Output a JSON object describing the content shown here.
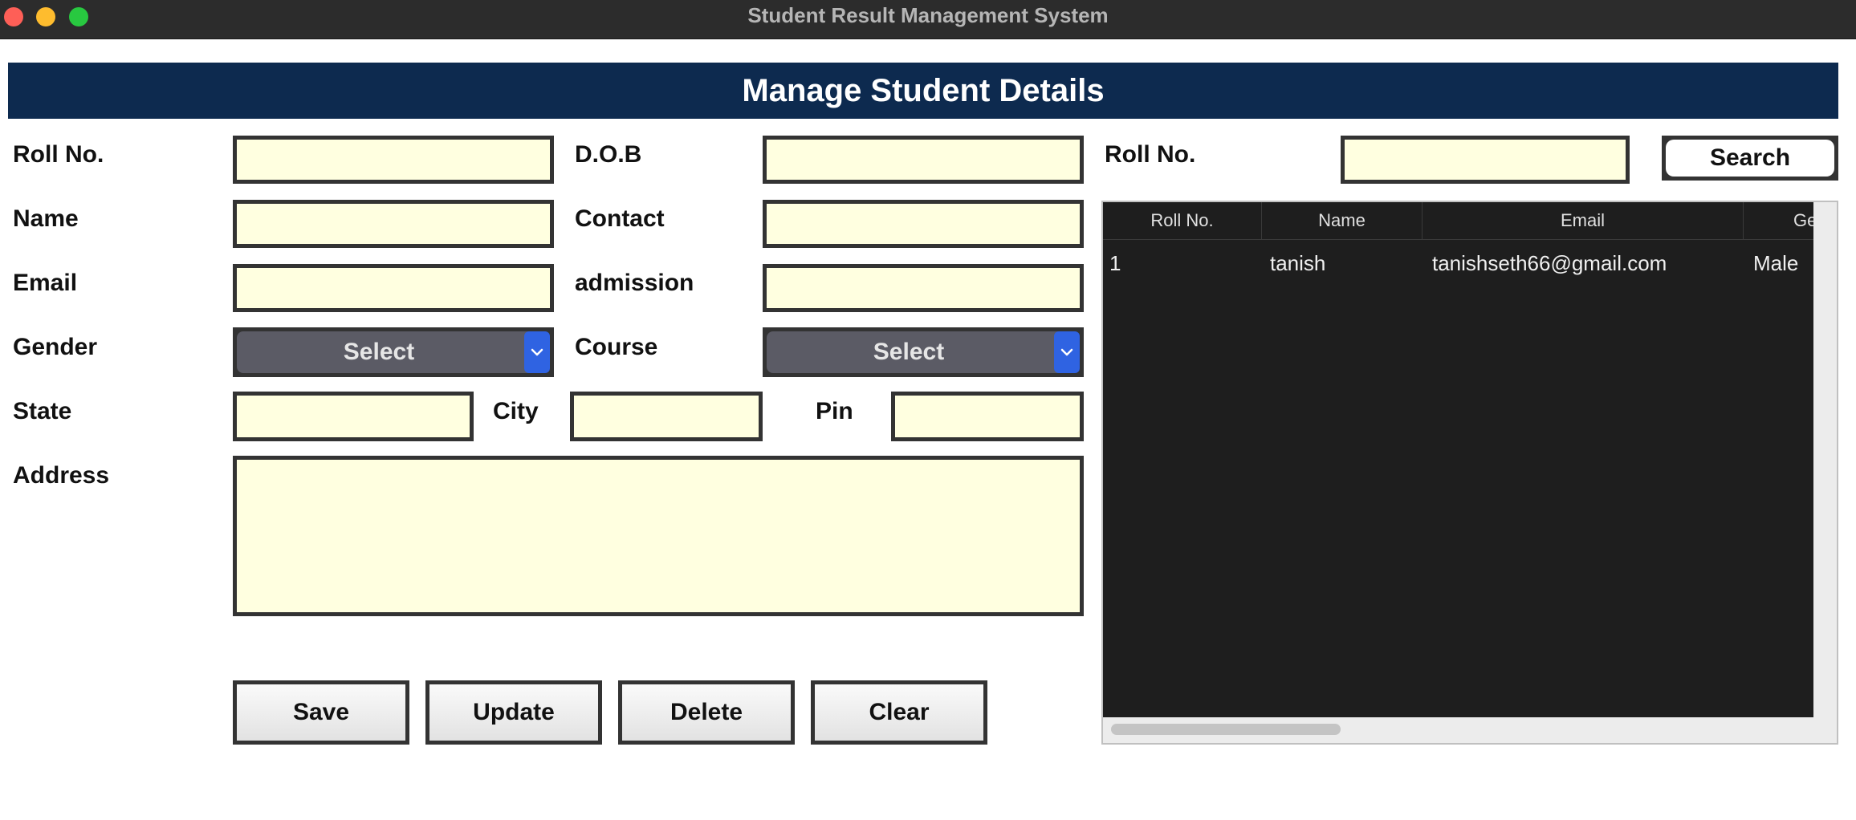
{
  "window": {
    "title": "Student Result Management System"
  },
  "header": {
    "title": "Manage Student Details"
  },
  "form": {
    "roll_label": "Roll No.",
    "dob_label": "D.O.B",
    "name_label": "Name",
    "contact_label": "Contact",
    "email_label": "Email",
    "admission_label": "admission",
    "gender_label": "Gender",
    "gender_value": "Select",
    "course_label": "Course",
    "course_value": "Select",
    "state_label": "State",
    "city_label": "City",
    "pin_label": "Pin",
    "address_label": "Address"
  },
  "buttons": {
    "save": "Save",
    "update": "Update",
    "delete": "Delete",
    "clear": "Clear"
  },
  "search": {
    "label": "Roll No.",
    "button": "Search"
  },
  "table": {
    "columns": [
      "Roll No.",
      "Name",
      "Email",
      "Ge"
    ],
    "rows": [
      [
        "1",
        "tanish",
        "tanishseth66@gmail.com",
        "Male"
      ]
    ]
  },
  "colors": {
    "banner": "#0d2a4f",
    "input_bg": "#ffffe0",
    "table_bg": "#1e1e1e",
    "dropdown_arrow": "#2f63e2"
  },
  "icons": [
    "close-light",
    "minimize-light",
    "zoom-light",
    "chevron-down-icon"
  ]
}
